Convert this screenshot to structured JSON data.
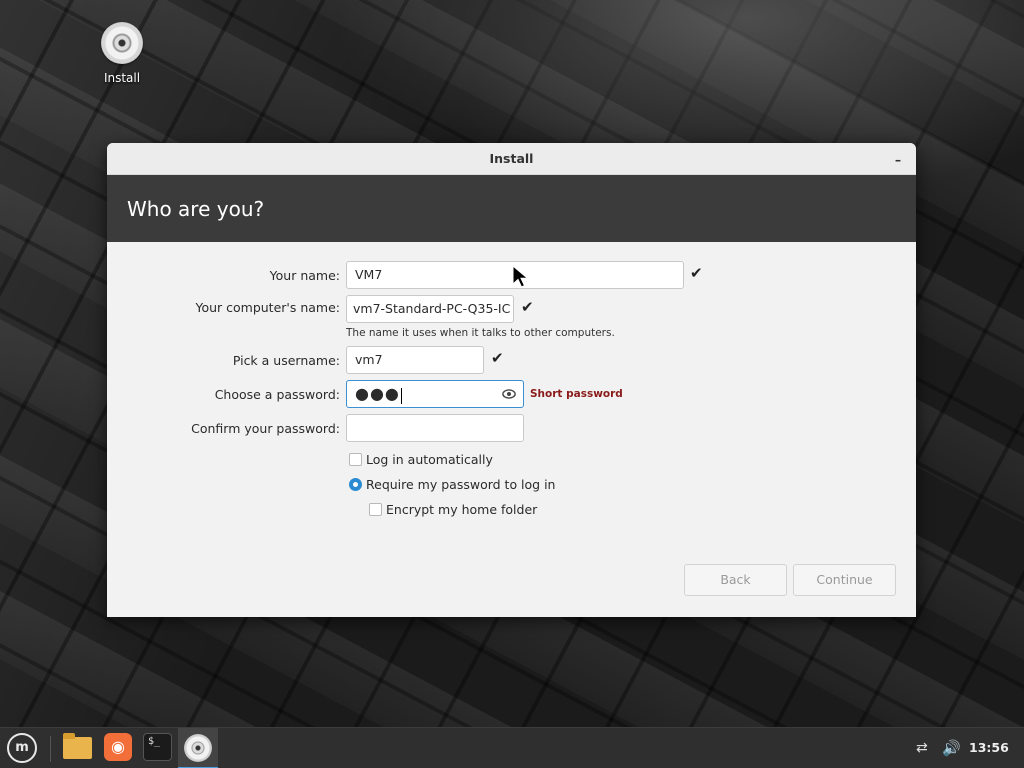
{
  "desktop": {
    "icons": [
      {
        "label": "Install",
        "icon": "disc-icon"
      }
    ]
  },
  "window": {
    "title": "Install",
    "minimize_label": "–",
    "header": "Who are you?",
    "form": {
      "name": {
        "label": "Your name:",
        "value": "VM7",
        "valid": true
      },
      "computer": {
        "label": "Your computer's name:",
        "value": "vm7-Standard-PC-Q35-IC",
        "hint": "The name it uses when it talks to other computers.",
        "valid": true
      },
      "username": {
        "label": "Pick a username:",
        "value": "vm7",
        "valid": true
      },
      "password": {
        "label": "Choose a password:",
        "value": "●●●",
        "strength": "Short password",
        "strength_color": "#8b1a1a"
      },
      "confirm": {
        "label": "Confirm your password:",
        "value": ""
      },
      "options": {
        "auto_login": {
          "label": "Log in automatically",
          "checked": false
        },
        "require_password": {
          "label": "Require my password to log in",
          "selected": true
        },
        "encrypt_home": {
          "label": "Encrypt my home folder",
          "checked": false
        }
      }
    },
    "buttons": {
      "back": "Back",
      "continue": "Continue"
    }
  },
  "colors": {
    "accent": "#2a8bd3",
    "header_band": "#3b3b3b"
  },
  "taskbar": {
    "menu_glyph": "m",
    "firefox_glyph": "◉",
    "terminal_glyph": "$_",
    "net_glyph": "⇄",
    "vol_glyph": "🔊",
    "clock": "13:56",
    "launchers": [
      "files-icon",
      "firefox-icon",
      "terminal-icon",
      "install-icon"
    ]
  }
}
